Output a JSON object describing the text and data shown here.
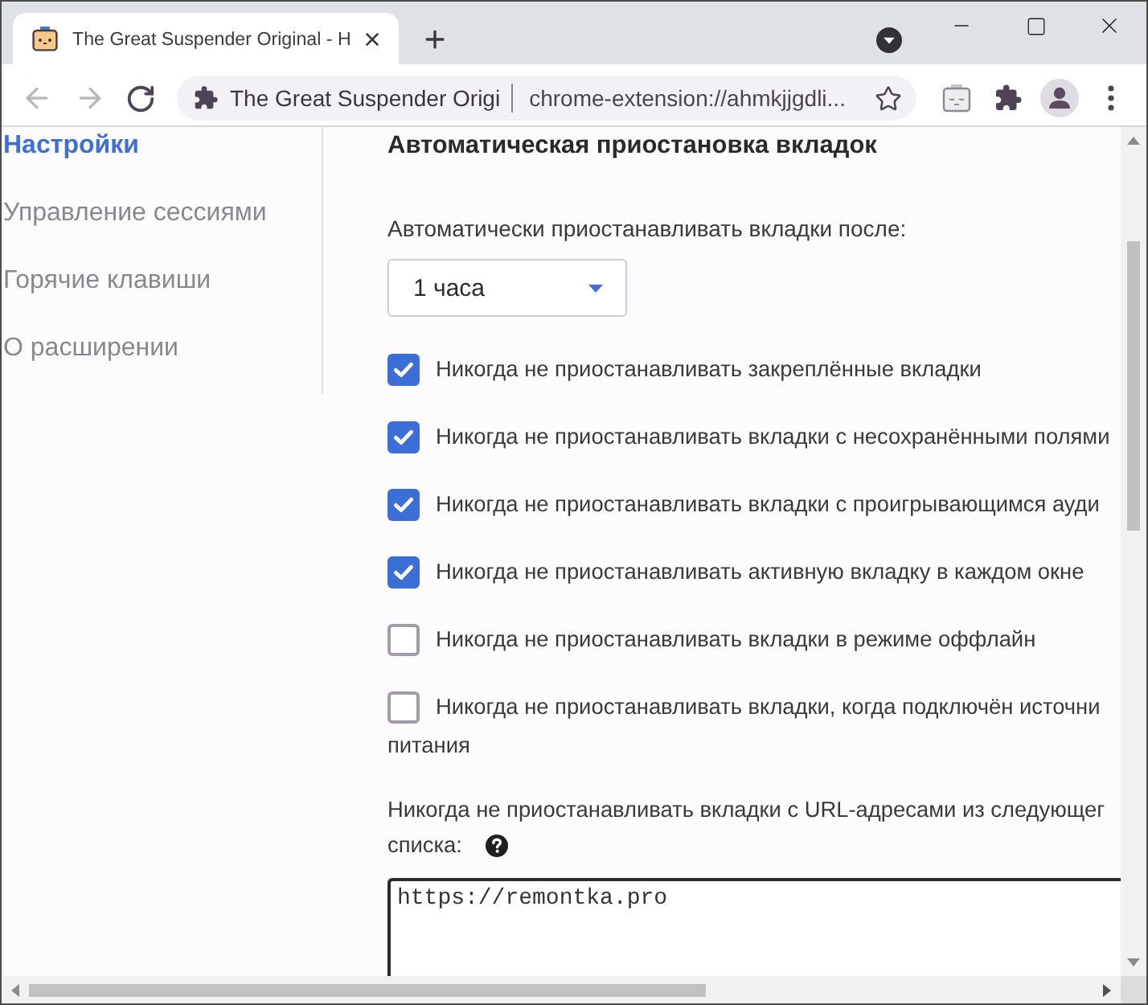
{
  "window": {
    "tab": {
      "title": "The Great Suspender Original - H",
      "selected": true
    }
  },
  "toolbar": {
    "back": {
      "disabled": true
    },
    "forward": {
      "disabled": true
    },
    "address_bar": {
      "site_name": "The Great Suspender Origi",
      "url": "chrome-extension://ahmkjjgdli..."
    }
  },
  "sidebar": {
    "items": [
      {
        "label": "Настройки",
        "selected": true
      },
      {
        "label": "Управление сессиями",
        "selected": false
      },
      {
        "label": "Горячие клавиши",
        "selected": false
      },
      {
        "label": "О расширении",
        "selected": false
      }
    ]
  },
  "settings": {
    "heading": "Автоматическая приостановка вкладок",
    "suspend_after": {
      "label": "Автоматически приостанавливать вкладки после:",
      "value": "1 часа"
    },
    "options": [
      {
        "lines": [
          "Никогда не приостанавливать закреплённые вкладки"
        ],
        "checked": true
      },
      {
        "lines": [
          "Никогда не приостанавливать вкладки с несохранёнными полями"
        ],
        "checked": true
      },
      {
        "lines": [
          "Никогда не приостанавливать вкладки с проигрывающимся ауди"
        ],
        "checked": true
      },
      {
        "lines": [
          "Никогда не приостанавливать активную вкладку в каждом окне"
        ],
        "checked": true
      },
      {
        "lines": [
          "Никогда не приостанавливать вкладки в режиме оффлайн"
        ],
        "checked": false
      },
      {
        "lines": [
          "Никогда не приостанавливать вкладки, когда подключён источни",
          "питания"
        ],
        "checked": false
      }
    ],
    "whitelist": {
      "label_lines": [
        "Никогда не приостанавливать вкладки с URL-адресами из следующег",
        "списка:"
      ],
      "value": "https://remontka.pro"
    }
  }
}
